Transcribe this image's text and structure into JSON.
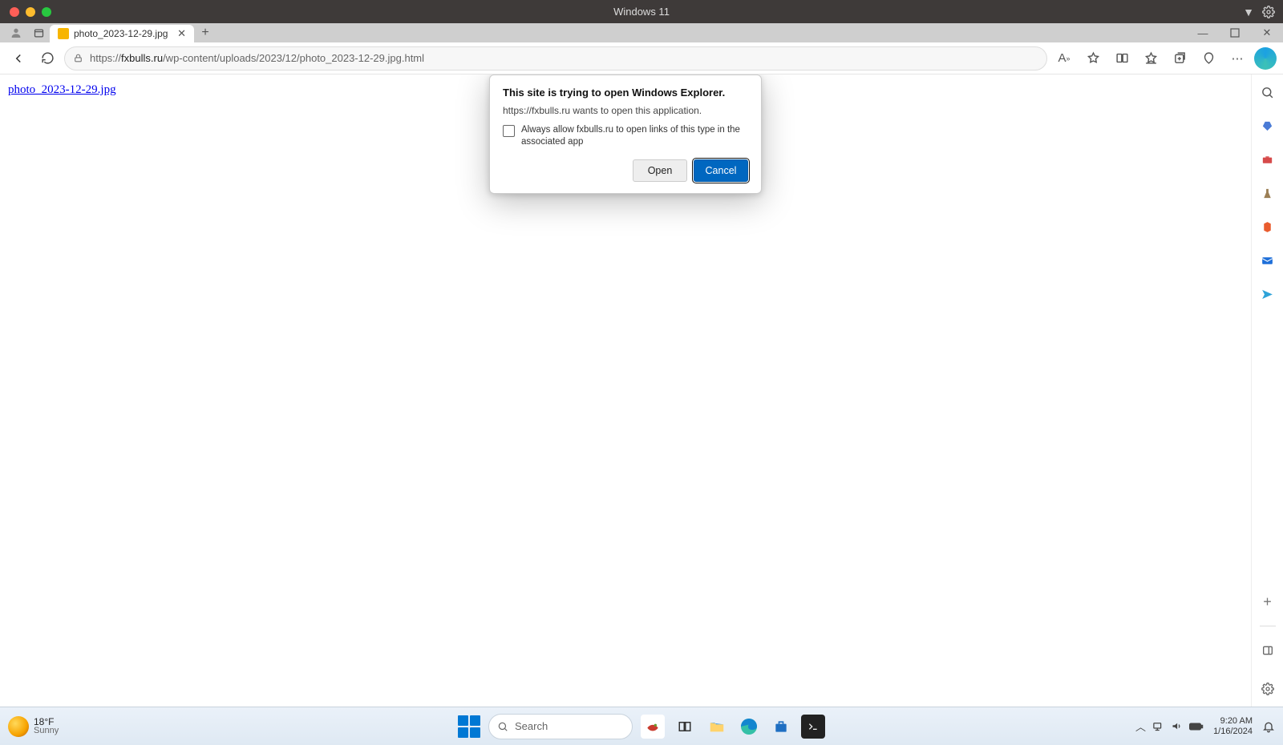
{
  "vm": {
    "title": "Windows 11"
  },
  "tab": {
    "title": "photo_2023-12-29.jpg"
  },
  "url": {
    "scheme": "https://",
    "host": "fxbulls.ru",
    "path": "/wp-content/uploads/2023/12/photo_2023-12-29.jpg.html"
  },
  "page": {
    "link_text": "photo_2023-12-29.jpg"
  },
  "dialog": {
    "title": "This site is trying to open Windows Explorer.",
    "body": "https://fxbulls.ru wants to open this application.",
    "checkbox_label": "Always allow fxbulls.ru to open links of this type in the associated app",
    "open_label": "Open",
    "cancel_label": "Cancel"
  },
  "taskbar": {
    "weather_temp": "18°F",
    "weather_cond": "Sunny",
    "search_placeholder": "Search",
    "clock_time": "9:20 AM",
    "clock_date": "1/16/2024"
  }
}
